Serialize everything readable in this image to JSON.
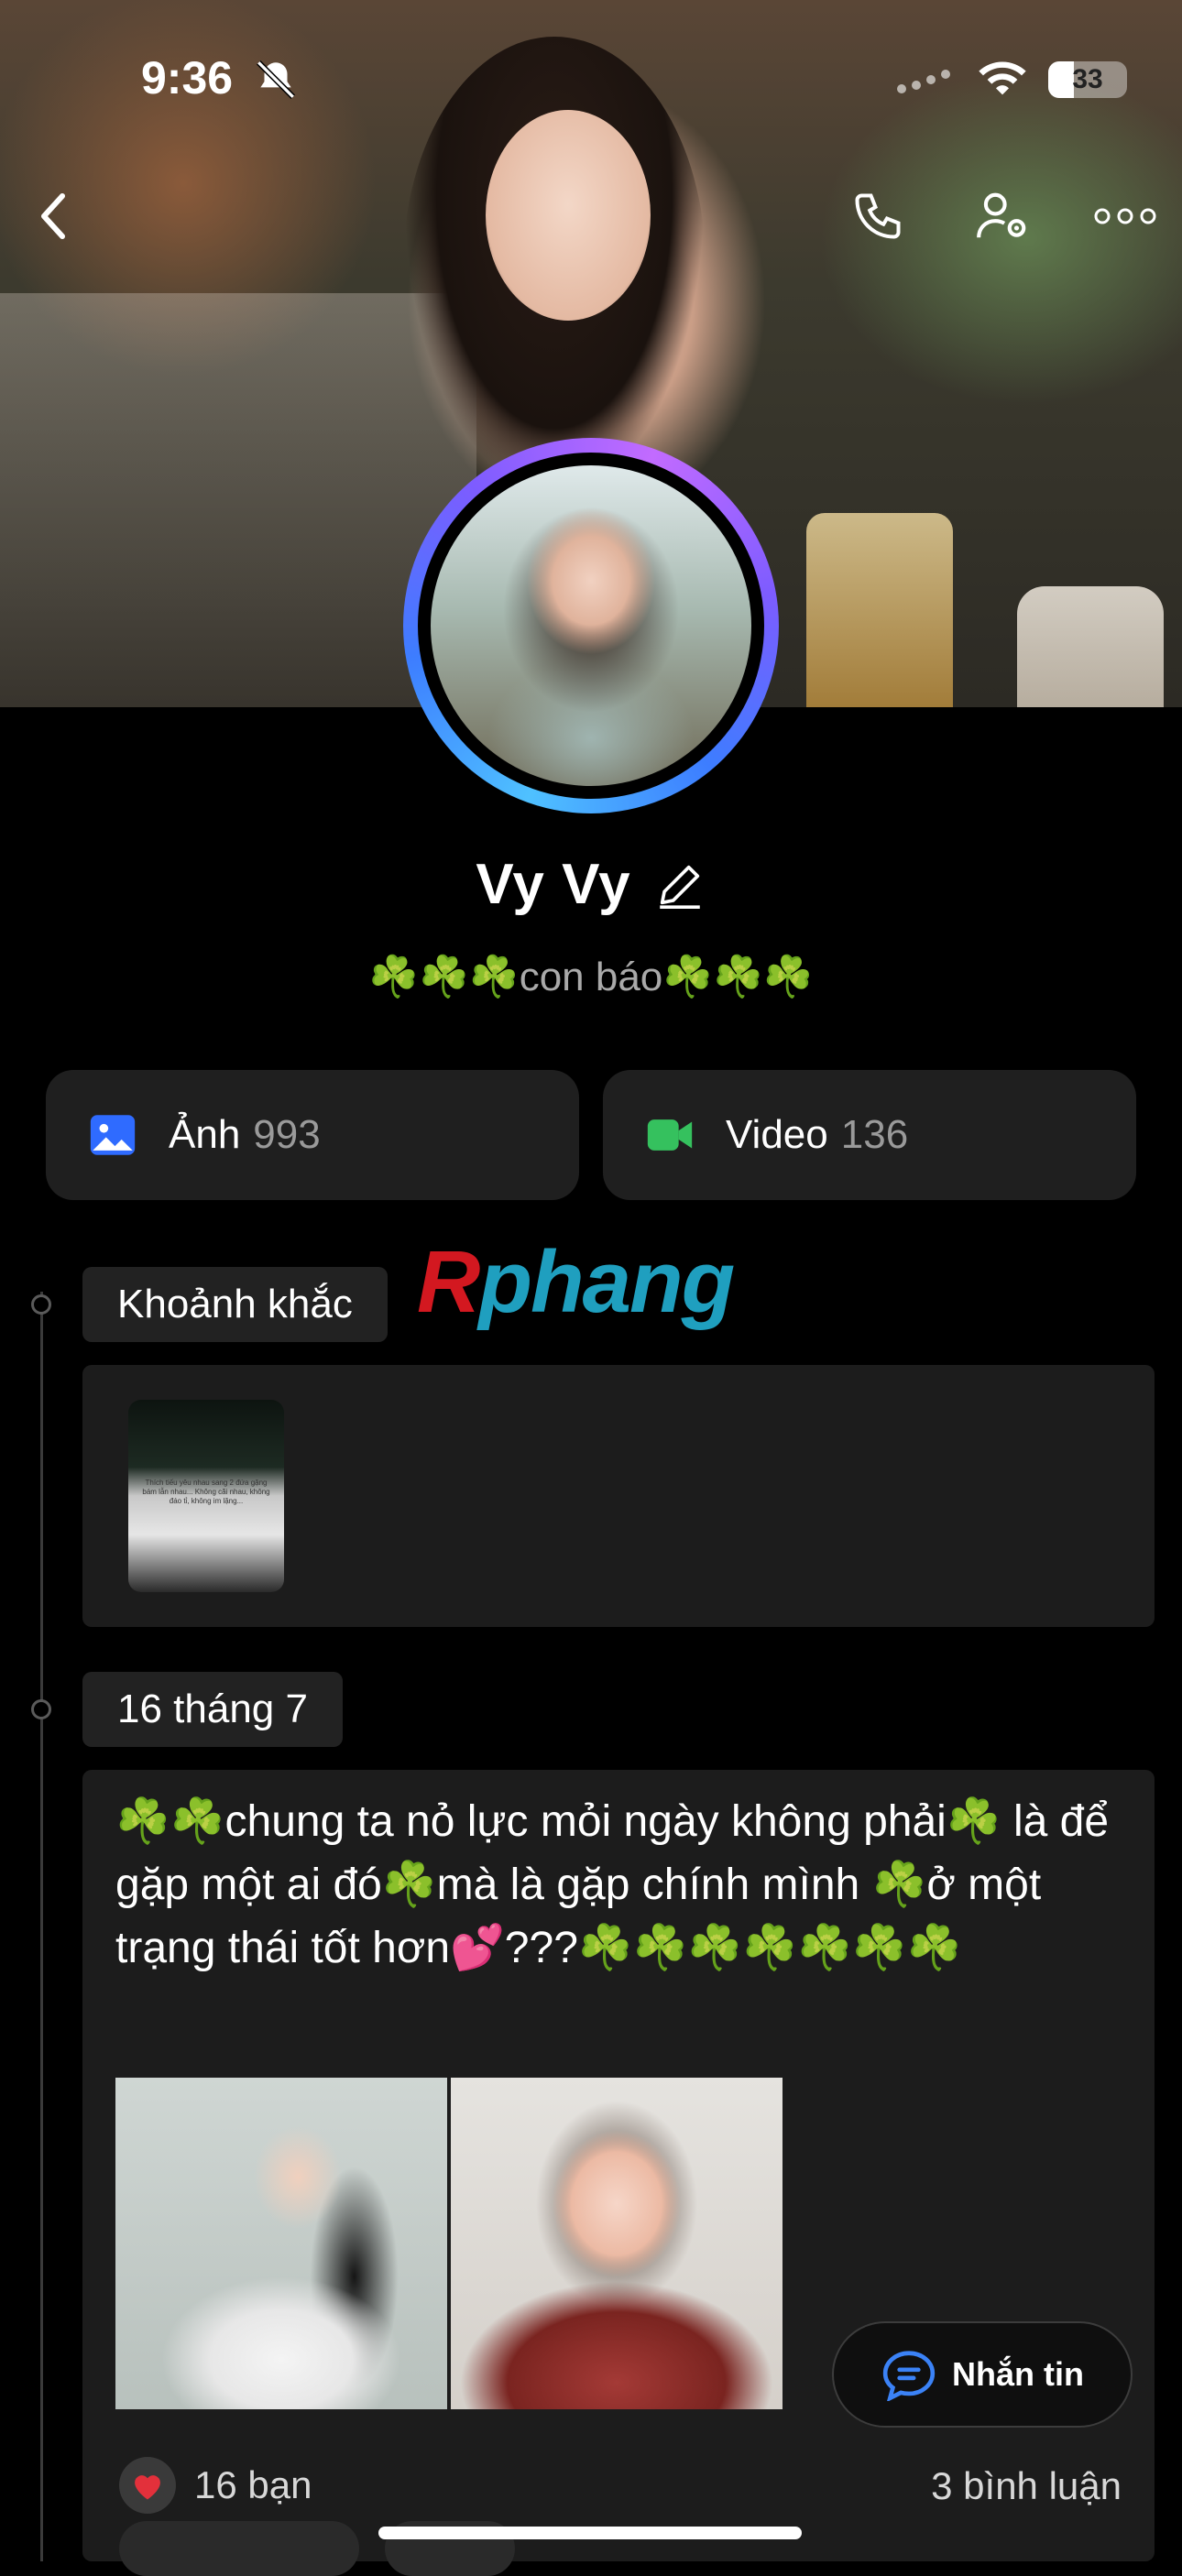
{
  "status_bar": {
    "time": "9:36",
    "battery": "33"
  },
  "profile": {
    "name": "Vy Vy",
    "bio": "☘️☘️☘️con báo☘️☘️☘️"
  },
  "media": {
    "photos": {
      "label": "Ảnh",
      "count": "993"
    },
    "videos": {
      "label": "Video",
      "count": "136"
    }
  },
  "watermark": {
    "part1": "R",
    "part2": "phang"
  },
  "timeline": {
    "moments_label": "Khoảnh khắc",
    "moment_thumb_text": "Thích tiếu yêu nhau sang 2 đứa gặng bám lẫn nhau... Không cãi nhau, không đáo tỉ, không im lặng...",
    "date_label": "16 tháng 7"
  },
  "post": {
    "text": "☘️☘️chung ta nỏ lực mỏi ngày không phải☘️ là để gặp một ai đó☘️mà là gặp chính mình ☘️ở một trạng thái tốt hơn💕???☘️☘️☘️☘️☘️☘️☘️",
    "likes": "16 bạn",
    "comments": "3 bình luận"
  },
  "message_button": {
    "label": "Nhắn tin"
  },
  "colors": {
    "background": "#000000",
    "card": "#1c1c1c",
    "photo_icon": "#2f6bff",
    "video_icon": "#35c15e",
    "message_icon": "#3b82f6",
    "heart": "#e3303b"
  },
  "icons": {
    "back": "chevron-left-icon",
    "call": "phone-icon",
    "profile_settings": "user-gear-icon",
    "more": "more-dots-icon",
    "edit": "pencil-icon",
    "photos": "image-icon",
    "videos": "video-camera-icon",
    "message": "chat-bubble-icon",
    "like": "heart-icon"
  }
}
